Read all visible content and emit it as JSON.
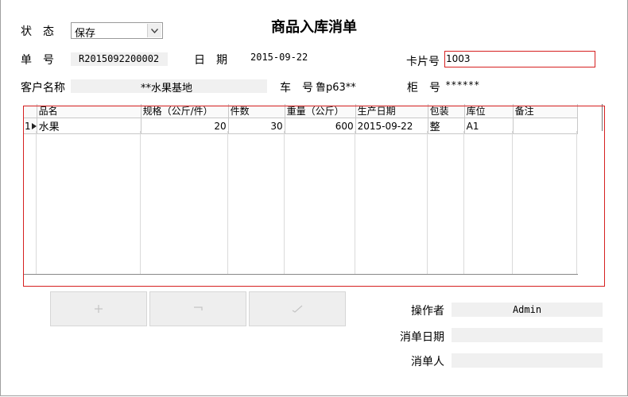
{
  "form": {
    "title": "商品入库消单",
    "status_label": "状　态",
    "status_value": "保存",
    "order_no_label": "单　号",
    "order_no_value": "R2015092200002",
    "date_label": "日　期",
    "date_value": "2015-09-22",
    "card_no_label": "卡片号",
    "card_no_value": "1003",
    "customer_label": "客户名称",
    "customer_value": "**水果基地",
    "plate_label": "车　号",
    "plate_value": "鲁p63**",
    "cabinet_label": "柜　号",
    "cabinet_value": "******"
  },
  "grid": {
    "columns": [
      "品名",
      "规格（公斤/件）",
      "件数",
      "重量（公斤）",
      "生产日期",
      "包装",
      "库位",
      "备注"
    ],
    "rows": [
      {
        "index": "1",
        "name": "水果",
        "spec": "20",
        "count": "30",
        "weight": "600",
        "prod_date": "2015-09-22",
        "pack": "整",
        "location": "A1",
        "note": ""
      }
    ]
  },
  "buttons": {
    "add_icon": "plus-icon",
    "remove_icon": "minus-icon",
    "confirm_icon": "check-icon"
  },
  "footer": {
    "operator_label": "操作者",
    "operator_value": "Admin",
    "cancel_date_label": "消单日期",
    "cancel_date_value": "",
    "canceler_label": "消单人",
    "canceler_value": ""
  }
}
